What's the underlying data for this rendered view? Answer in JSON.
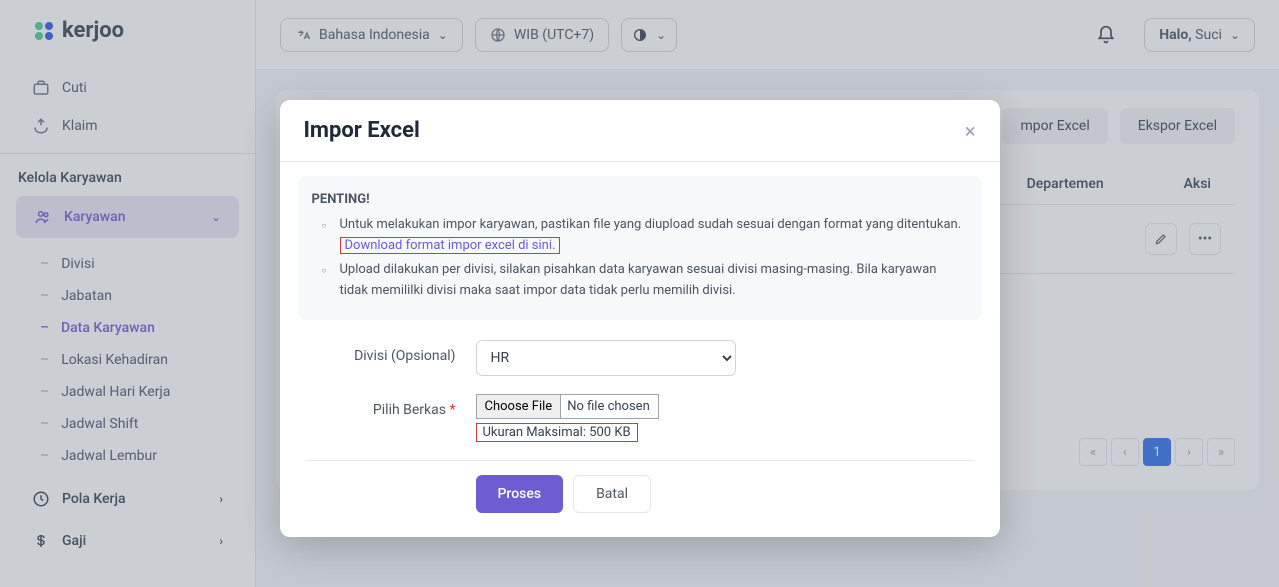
{
  "brand": "kerjoo",
  "topbar": {
    "language": "Bahasa Indonesia",
    "timezone": "WIB (UTC+7)",
    "greeting": "Halo,",
    "user": "Suci"
  },
  "sidebar": {
    "top_items": [
      {
        "icon": "briefcase",
        "label": "Cuti"
      },
      {
        "icon": "hand",
        "label": "Klaim"
      }
    ],
    "section_title": "Kelola Karyawan",
    "parent_label": "Karyawan",
    "sub_items": [
      "Divisi",
      "Jabatan",
      "Data Karyawan",
      "Lokasi Kehadiran",
      "Jadwal Hari Kerja",
      "Jadwal Shift",
      "Jadwal Lembur"
    ],
    "active_sub": 2,
    "collapsed_items": [
      {
        "icon": "clock",
        "label": "Pola Kerja"
      },
      {
        "icon": "dollar",
        "label": "Gaji"
      }
    ]
  },
  "page": {
    "import_btn": "Impor Excel",
    "export_btn": "Ekspor Excel",
    "col_dept": "Departemen",
    "col_action": "Aksi",
    "import_btn_cut": "mpor Excel"
  },
  "pagination": {
    "current": "1"
  },
  "modal": {
    "title": "Impor Excel",
    "alert_head": "PENTING!",
    "alert_line1_a": "Untuk melakukan impor karyawan, pastikan file yang diupload sudah sesuai dengan format yang ditentukan. ",
    "alert_link": "Download format impor excel di sini.",
    "alert_line2": "Upload dilakukan per divisi, silakan pisahkan data karyawan sesuai divisi masing-masing. Bila karyawan tidak memililki divisi maka saat impor data tidak perlu memilih divisi.",
    "label_divisi": "Divisi (Opsional)",
    "divisi_value": "HR",
    "label_file": "Pilih Berkas",
    "file_btn": "Choose File",
    "file_none": "No file chosen",
    "file_hint": "Ukuran Maksimal: 500 KB",
    "submit": "Proses",
    "cancel": "Batal"
  }
}
